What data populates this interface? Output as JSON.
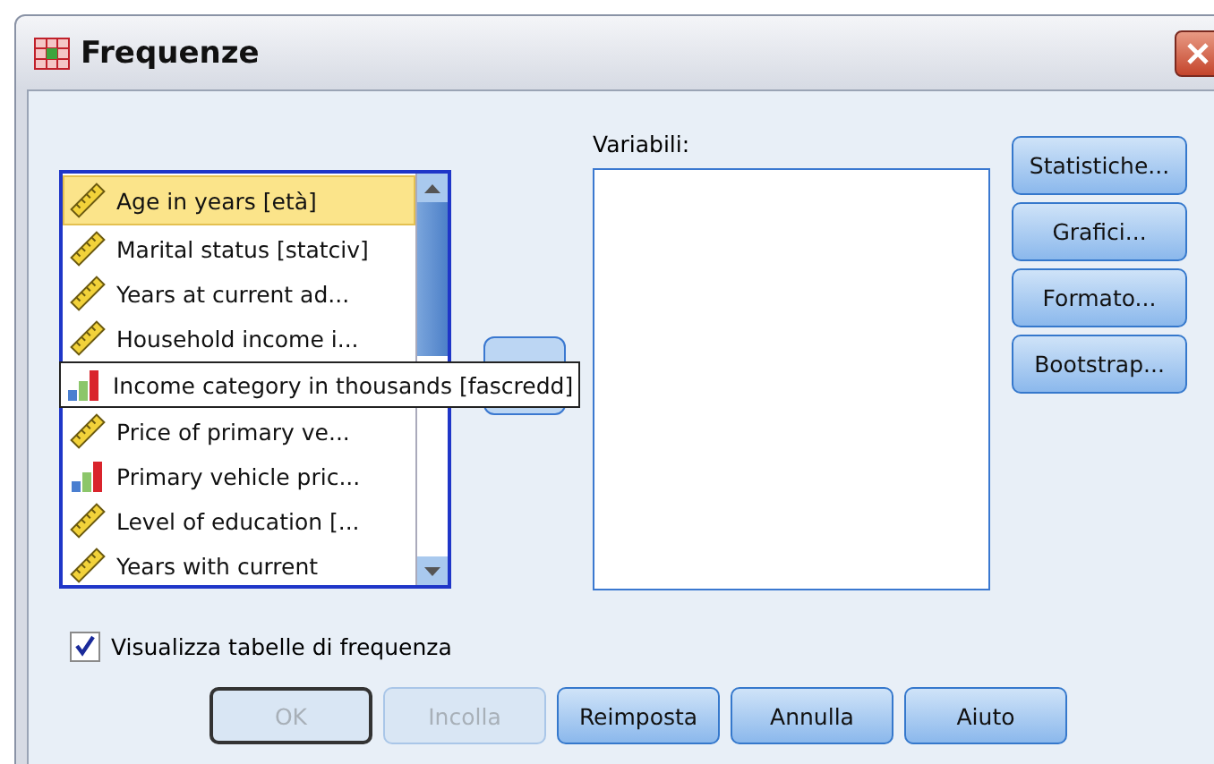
{
  "window": {
    "title": "Frequenze"
  },
  "source_list": {
    "items": [
      {
        "label": "Age in years [età]",
        "kind": "scale",
        "selected": true,
        "tooltip": false
      },
      {
        "label": "Marital status [statciv]",
        "kind": "scale",
        "selected": false,
        "tooltip": false
      },
      {
        "label": "Years at current ad...",
        "kind": "scale",
        "selected": false,
        "tooltip": false
      },
      {
        "label": "Household income i...",
        "kind": "scale",
        "selected": false,
        "tooltip": false
      },
      {
        "label": "Income category in thousands [fascredd]",
        "kind": "ordinal",
        "selected": false,
        "tooltip": true
      },
      {
        "label": "Price of primary ve...",
        "kind": "scale",
        "selected": false,
        "tooltip": false
      },
      {
        "label": "Primary vehicle pric...",
        "kind": "ordinal",
        "selected": false,
        "tooltip": false
      },
      {
        "label": "Level of education [...",
        "kind": "scale",
        "selected": false,
        "tooltip": false
      },
      {
        "label": "Years with current",
        "kind": "scale",
        "selected": false,
        "tooltip": false
      }
    ]
  },
  "variables": {
    "label": "Variabili:"
  },
  "side_buttons": [
    "Statistiche...",
    "Grafici...",
    "Formato...",
    "Bootstrap..."
  ],
  "checkbox": {
    "label": "Visualizza tabelle di frequenza",
    "checked": true
  },
  "buttons": [
    {
      "label": "OK",
      "disabled": true,
      "default": true
    },
    {
      "label": "Incolla",
      "disabled": true,
      "default": false
    },
    {
      "label": "Reimposta",
      "disabled": false,
      "default": false
    },
    {
      "label": "Annulla",
      "disabled": false,
      "default": false
    },
    {
      "label": "Aiuto",
      "disabled": false,
      "default": false
    }
  ]
}
